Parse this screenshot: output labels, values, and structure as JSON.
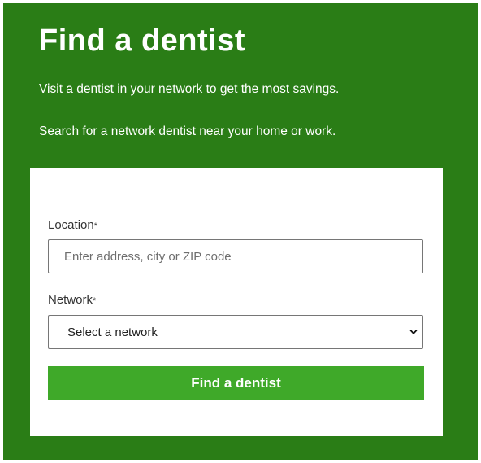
{
  "header": {
    "title": "Find a dentist",
    "intro": "Visit a dentist in your network to get the most savings.",
    "subintro": "Search for a network dentist near your home or work."
  },
  "form": {
    "location": {
      "label": "Location",
      "required_mark": "*",
      "placeholder": "Enter address, city or ZIP code",
      "value": ""
    },
    "network": {
      "label": "Network",
      "required_mark": "*",
      "selected": "Select a network",
      "icon": "chevron-down-icon"
    },
    "submit_label": "Find a dentist"
  },
  "colors": {
    "panel_background": "#2a7d16",
    "button_background": "#3fa929",
    "text_on_dark": "#ffffff"
  }
}
